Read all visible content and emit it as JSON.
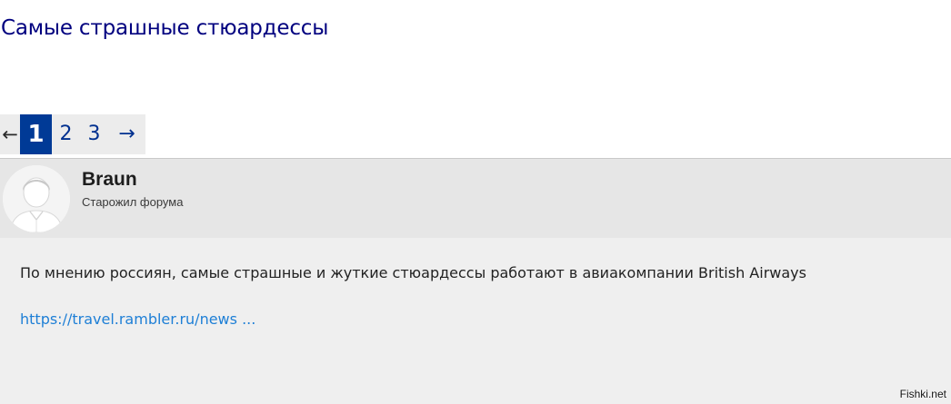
{
  "thread": {
    "title": "Самые страшные стюардессы"
  },
  "pager": {
    "prev": "←",
    "current": "1",
    "pages": [
      "2",
      "3"
    ],
    "next": "→",
    "active_color": "#003a96"
  },
  "post": {
    "author": {
      "name": "Braun",
      "rank": "Старожил форума",
      "avatar_icon": "default-user-avatar-icon"
    },
    "text": "По мнению россиян, самые страшные и жуткие стюардессы работают в авиакомпании British Airways",
    "link_text": "https://travel.rambler.ru/news ..."
  },
  "watermark": "Fishki.net",
  "colors": {
    "title": "#00007f",
    "link": "#1e7fd6",
    "post_bg": "#efefef",
    "header_bg": "#e6e6e6"
  }
}
